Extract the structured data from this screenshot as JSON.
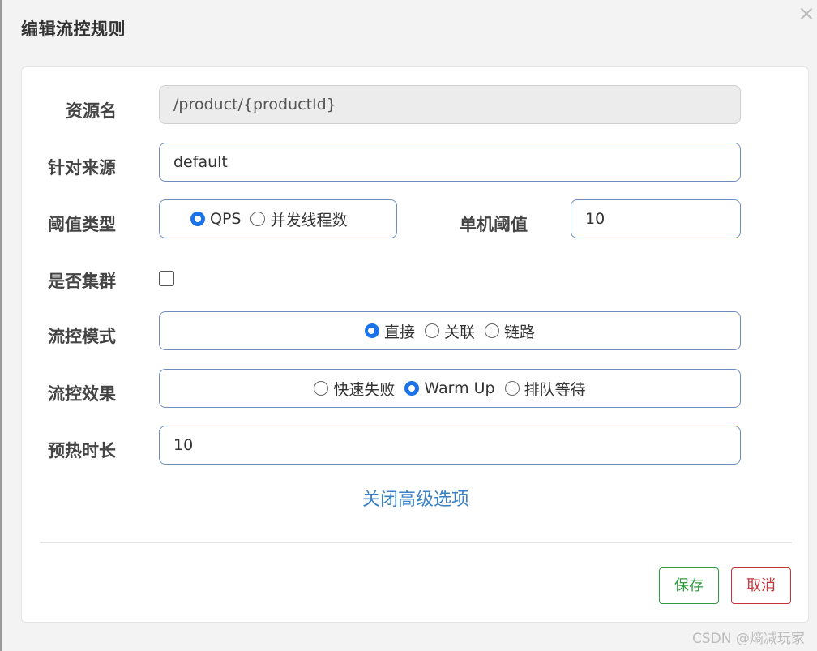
{
  "dialog": {
    "title": "编辑流控规则",
    "close_symbol": "×"
  },
  "form": {
    "resource_name": {
      "label": "资源名",
      "value": "/product/{productId}"
    },
    "limit_app": {
      "label": "针对来源",
      "value": "default"
    },
    "threshold_type": {
      "label": "阈值类型",
      "options": [
        {
          "label": "QPS",
          "checked": true
        },
        {
          "label": "并发线程数",
          "checked": false
        }
      ]
    },
    "single_threshold": {
      "label": "单机阈值",
      "value": "10"
    },
    "cluster": {
      "label": "是否集群",
      "checked": false
    },
    "flow_mode": {
      "label": "流控模式",
      "options": [
        {
          "label": "直接",
          "checked": true
        },
        {
          "label": "关联",
          "checked": false
        },
        {
          "label": "链路",
          "checked": false
        }
      ]
    },
    "flow_effect": {
      "label": "流控效果",
      "options": [
        {
          "label": "快速失败",
          "checked": false
        },
        {
          "label": "Warm Up",
          "checked": true
        },
        {
          "label": "排队等待",
          "checked": false
        }
      ]
    },
    "warmup_period": {
      "label": "预热时长",
      "value": "10"
    },
    "advanced_toggle": "关闭高级选项"
  },
  "buttons": {
    "save": "保存",
    "cancel": "取消"
  },
  "watermark": "CSDN @熵减玩家",
  "colors": {
    "accent": "#1a73e8",
    "input_border": "#6e8dbf",
    "link": "#3b82c4",
    "save": "#2e9b3e",
    "cancel": "#c7333a"
  }
}
